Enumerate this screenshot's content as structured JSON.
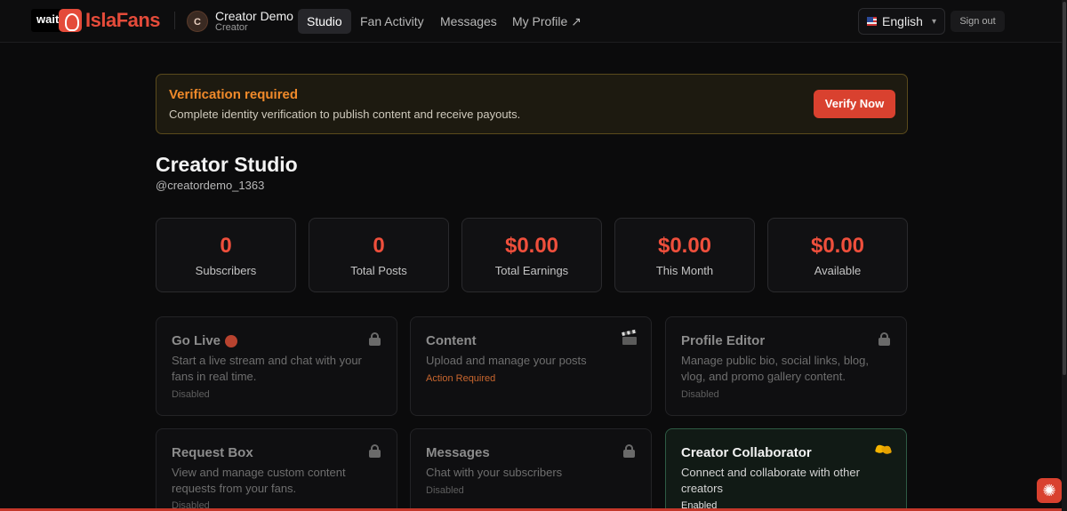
{
  "nav": {
    "badge": "wait",
    "brand": "IslaFans",
    "avatar_initial": "C",
    "user_name": "Creator Demo",
    "user_role": "Creator",
    "items": [
      {
        "label": "Studio"
      },
      {
        "label": "Fan Activity"
      },
      {
        "label": "Messages"
      },
      {
        "label": "My Profile ↗"
      }
    ],
    "language": "English",
    "sign_out": "Sign out"
  },
  "banner": {
    "title": "Verification required",
    "text": "Complete identity verification to publish content and receive payouts.",
    "button": "Verify Now"
  },
  "page": {
    "title": "Creator Studio",
    "handle": "@creatordemo_1363"
  },
  "stats": [
    {
      "value": "0",
      "label": "Subscribers"
    },
    {
      "value": "0",
      "label": "Total Posts"
    },
    {
      "value": "$0.00",
      "label": "Total Earnings"
    },
    {
      "value": "$0.00",
      "label": "This Month"
    },
    {
      "value": "$0.00",
      "label": "Available"
    }
  ],
  "cards": [
    {
      "title": "Go Live",
      "icon": "live-icon",
      "desc": "Start a live stream and chat with your fans in real time.",
      "status": "Disabled",
      "badge": "lock-icon"
    },
    {
      "title": "Content",
      "desc": "Upload and manage your posts",
      "status": "Action Required",
      "badge": "clapperboard-icon"
    },
    {
      "title": "Profile Editor",
      "desc": "Manage public bio, social links, blog, vlog, and promo gallery content.",
      "status": "Disabled",
      "badge": "lock-icon"
    },
    {
      "title": "Request Box",
      "desc": "View and manage custom content requests from your fans.",
      "status": "Disabled",
      "badge": "lock-icon"
    },
    {
      "title": "Messages",
      "desc": "Chat with your subscribers",
      "status": "Disabled",
      "badge": "lock-icon"
    },
    {
      "title": "Creator Collaborator",
      "desc": "Connect and collaborate with other creators",
      "status": "Enabled",
      "badge": "handshake-icon"
    }
  ],
  "colors": {
    "accent": "#ef4f3c",
    "warning": "#f08a2a",
    "enabled_border": "#2e5a44"
  }
}
